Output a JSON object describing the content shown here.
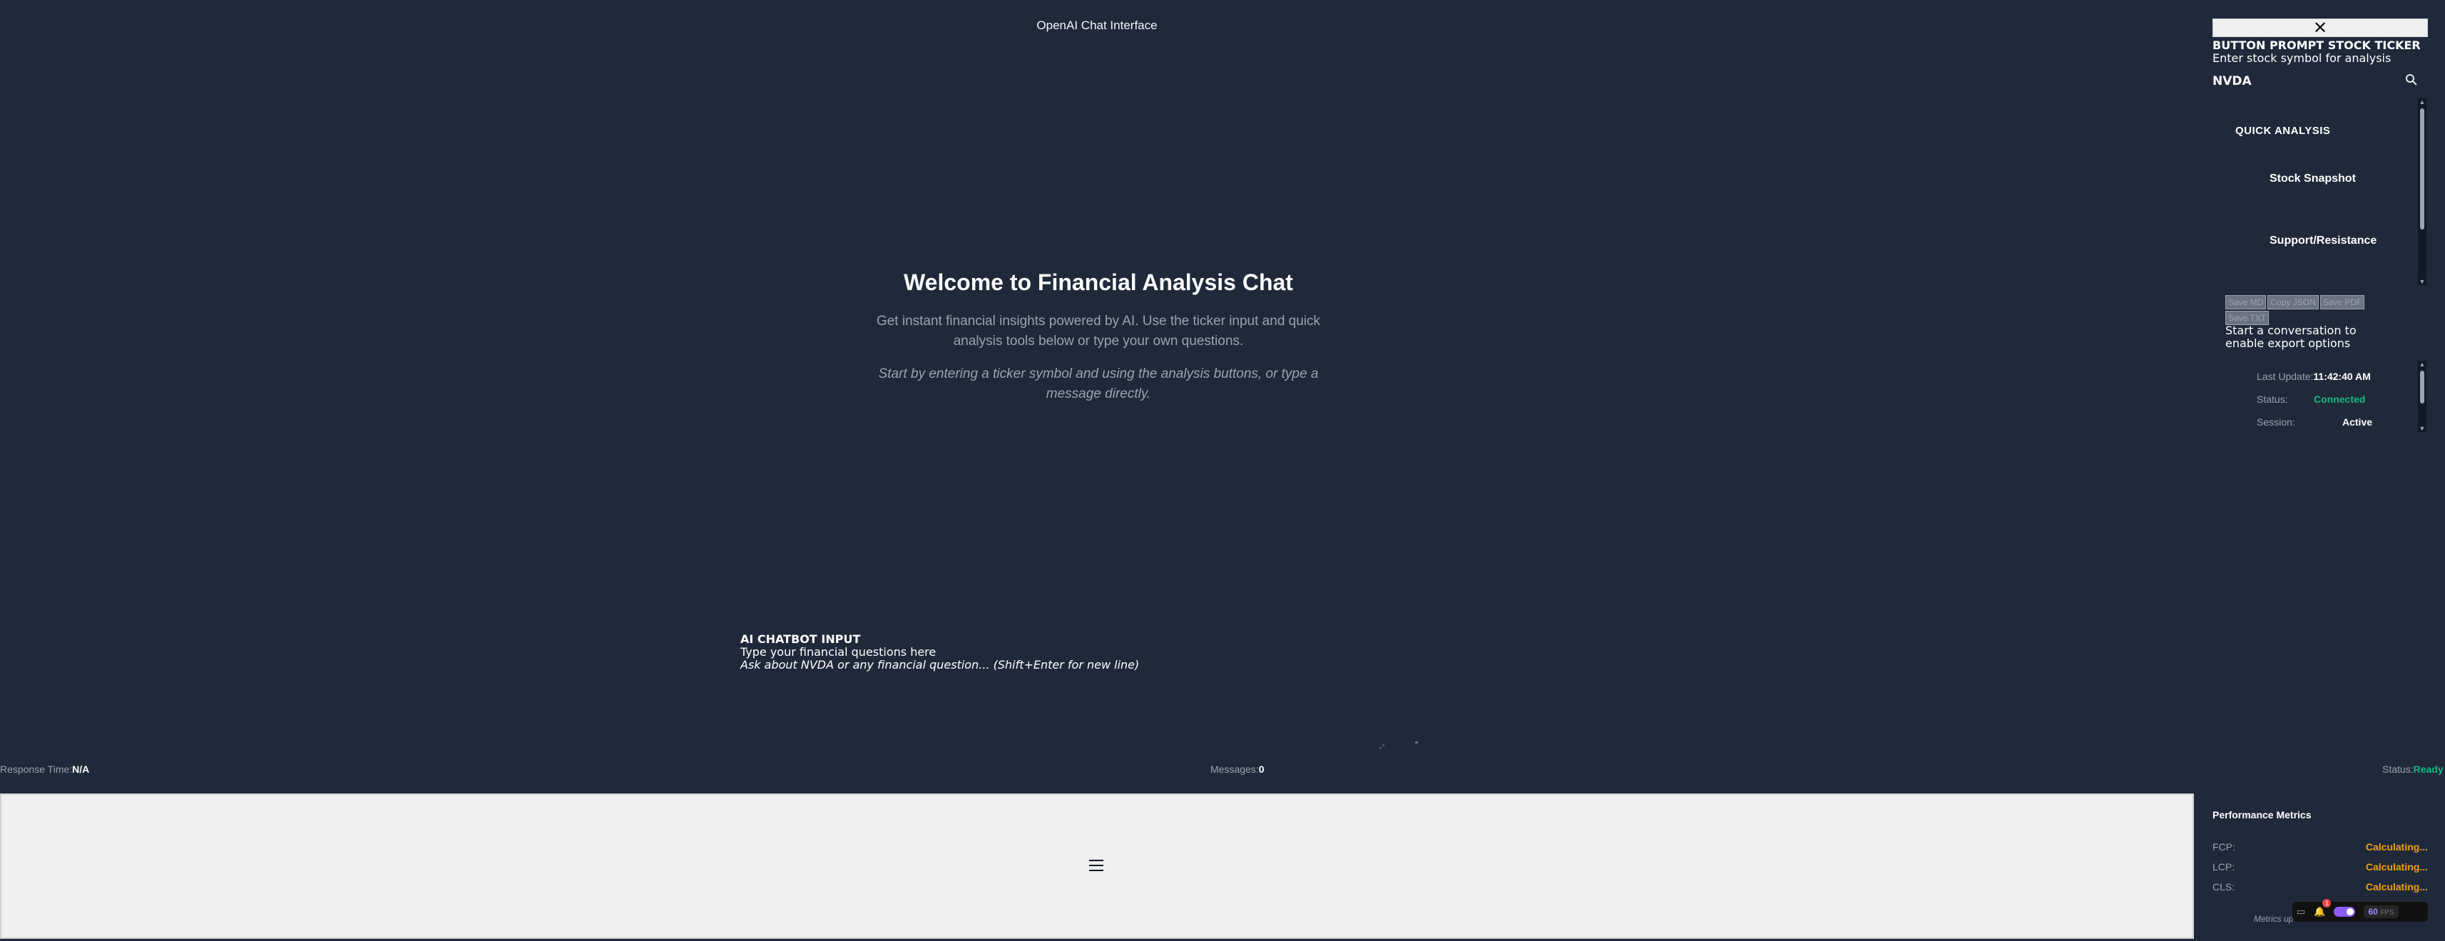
{
  "header": {
    "title": "OpenAI Chat Interface"
  },
  "welcome": {
    "heading": "Welcome to Financial Analysis Chat",
    "description": "Get instant financial insights powered by AI. Use the ticker input and quick analysis tools below or type your own questions.",
    "hint": "Start by entering a ticker symbol and using the analysis buttons, or type a message directly."
  },
  "chat_input": {
    "label": "AI CHATBOT INPUT",
    "sublabel": "Type your financial questions here",
    "placeholder": "Ask about NVDA or any financial question... (Shift+Enter for new line)"
  },
  "status_bar": {
    "response_time_label": "Response Time:",
    "response_time_value": "N/A",
    "messages_label": "Messages:",
    "messages_value": "0",
    "status_label": "Status:",
    "status_value": "Ready"
  },
  "sidebar": {
    "close_icon": "close-icon",
    "ticker": {
      "label": "BUTTON PROMPT STOCK TICKER",
      "sublabel": "Enter stock symbol for analysis",
      "value": "NVDA",
      "search_icon": "search-icon"
    },
    "quick_analysis": {
      "title": "QUICK ANALYSIS",
      "items": [
        {
          "label": "Stock Snapshot",
          "icon": ""
        },
        {
          "label": "Support/Resistance",
          "icon": ""
        }
      ]
    },
    "export": {
      "buttons": [
        "Save MD",
        "Copy JSON",
        "Save PDF",
        "Save TXT"
      ],
      "note": "Start a conversation to enable export options"
    },
    "info": {
      "last_update_label": "Last Update:",
      "last_update_value": "11:42:40 AM",
      "status_label": "Status:",
      "status_value": "Connected",
      "status_icon": "",
      "session_label": "Session:",
      "session_value": "Active"
    }
  },
  "performance": {
    "title": "Performance Metrics",
    "metrics": [
      {
        "label": "FCP:",
        "value": "Calculating..."
      },
      {
        "label": "LCP:",
        "value": "Calculating..."
      },
      {
        "label": "CLS:",
        "value": "Calculating..."
      }
    ],
    "note": "Metrics up"
  },
  "toolbar": {
    "notification_count": "1",
    "fps_value": "60",
    "fps_unit": "FPS"
  },
  "colors": {
    "background": "#1f293a",
    "success": "#10b981",
    "warning": "#f59e0b",
    "accent": "#8b5cf6"
  }
}
